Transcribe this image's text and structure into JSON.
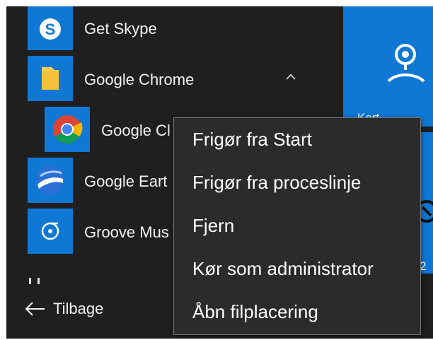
{
  "colors": {
    "menu_bg": "#1f1f1f",
    "tile_blue": "#0f78d4",
    "context_bg": "#2b2b2b",
    "context_border": "#767676",
    "text": "#f2f2f2"
  },
  "apps": [
    {
      "label": "Get Skype",
      "icon": "skype-icon"
    },
    {
      "label": "Google Chrome",
      "icon": "folder-icon",
      "expanded": true
    },
    {
      "label": "Google Cl",
      "icon": "chrome-icon"
    },
    {
      "label": "Google Eart",
      "icon": "google-earth-icon"
    },
    {
      "label": "Groove Mus",
      "icon": "groove-music-icon"
    }
  ],
  "back": {
    "label": "Tilbage",
    "icon": "arrow-left-icon"
  },
  "tiles": {
    "maps_label": "Kort",
    "tile2_label": "2"
  },
  "context_menu": {
    "items": [
      "Frigør fra Start",
      "Frigør fra proceslinje",
      "Fjern",
      "Kør som administrator",
      "Åbn filplacering"
    ]
  }
}
